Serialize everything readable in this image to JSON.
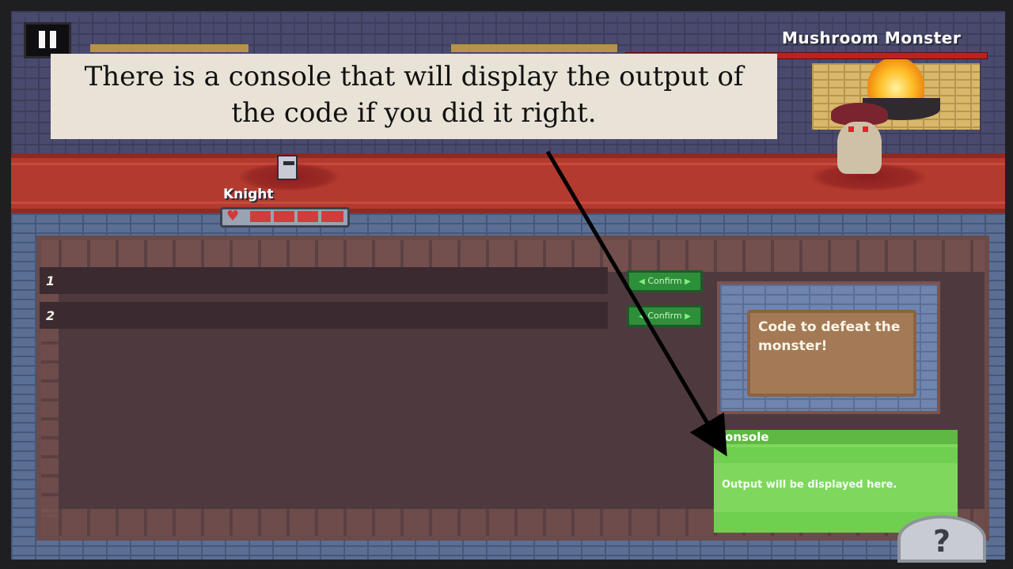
{
  "hud": {
    "pause_icon": "pause-icon",
    "boss_name": "Mushroom Monster",
    "boss_health_fraction": 1.0,
    "help_label": "?"
  },
  "player": {
    "name": "Knight",
    "heart_icon": "heart-icon",
    "hp_segments_filled": 5,
    "hp_segments_total": 5
  },
  "editor": {
    "lines": [
      {
        "number": "1",
        "confirm_label": "Confirm"
      },
      {
        "number": "2",
        "confirm_label": "Confirm"
      }
    ]
  },
  "hint_panel": {
    "text": "Code to defeat the monster!"
  },
  "console": {
    "title": "Console",
    "output": "Output will be displayed here."
  },
  "tutorial": {
    "text": "There is a console that will display the output of the code if you did it right."
  },
  "colors": {
    "carpet": "#b23a2f",
    "console_bg": "#7fd85d",
    "confirm_bg": "#2e8f3b",
    "tooltip_bg": "#e9e3d7"
  }
}
